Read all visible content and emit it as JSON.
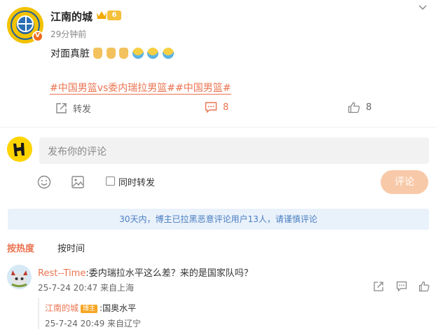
{
  "post": {
    "username": "江南的城",
    "vip_level": "6",
    "time": "29分钟前",
    "text": "对面真脏",
    "emojis": [
      "thumbs-up",
      "thumbs-up",
      "thumbs-up",
      "doge",
      "doge",
      "doge"
    ],
    "hashtag_1": "#中国男篮vs委内瑞拉男篮#",
    "hashtag_2": "#中国男篮#",
    "share_label": "转发",
    "comment_count": "8",
    "like_count": "8"
  },
  "compose": {
    "placeholder": "发布你的评论",
    "repost_label": "同时转发",
    "submit_label": "评论"
  },
  "notice": "30天内，博主已拉黑恶意评论用户13人，请谨慎评论",
  "sort": {
    "hot": "按热度",
    "time": "按时间"
  },
  "comments": [
    {
      "author": "Rest--Time",
      "text": ":委内瑞拉水平这么差？来的是国家队吗？",
      "meta": "25-7-24 20:47 来自上海",
      "reply": {
        "author": "江南的城",
        "badge": "博主",
        "text": ":国奥水平",
        "meta": "25-7-24 20:49 来自辽宁"
      }
    }
  ],
  "colors": {
    "accent": "#eb7350",
    "notice_bg": "#e9f1fb",
    "notice_text": "#4a7ec0",
    "submit_disabled": "#f8c9a8"
  }
}
